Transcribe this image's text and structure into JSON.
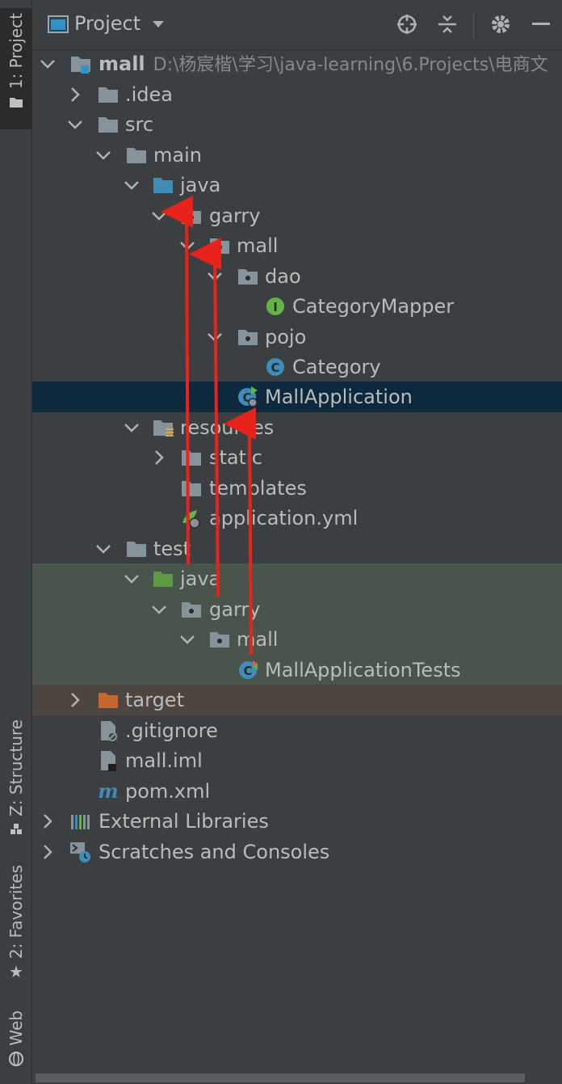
{
  "left_strip": {
    "project_tab": "1: Project",
    "structure_tab": "Z: Structure",
    "favorites_tab": "2: Favorites",
    "web_tab": "Web"
  },
  "header": {
    "title": "Project",
    "icons": [
      "dropdown-icon",
      "locate-icon",
      "collapse-all-icon",
      "settings-gear-icon",
      "minimize-icon"
    ]
  },
  "tree": {
    "root": {
      "name": "mall",
      "path": "D:\\杨宸楷\\学习\\java-learning\\6.Projects\\电商文"
    },
    "idea": ".idea",
    "src": "src",
    "main": "main",
    "main_java": "java",
    "garry": "garry",
    "mall_pkg": "mall",
    "dao": "dao",
    "category_mapper": "CategoryMapper",
    "pojo": "pojo",
    "category": "Category",
    "mall_application": "MallApplication",
    "resources": "resources",
    "static": "static",
    "templates": "templates",
    "application_yml": "application.yml",
    "test": "test",
    "test_java": "java",
    "test_garry": "garry",
    "test_mall": "mall",
    "mall_application_tests": "MallApplicationTests",
    "target": "target",
    "gitignore": ".gitignore",
    "mall_iml": "mall.iml",
    "pom_xml": "pom.xml",
    "external_libraries": "External Libraries",
    "scratches": "Scratches and Consoles"
  },
  "colors": {
    "selection": "#0d293e",
    "test_highlight": "#49544a",
    "target_highlight": "#4d4640",
    "annotation_arrow": "#e8231c"
  }
}
